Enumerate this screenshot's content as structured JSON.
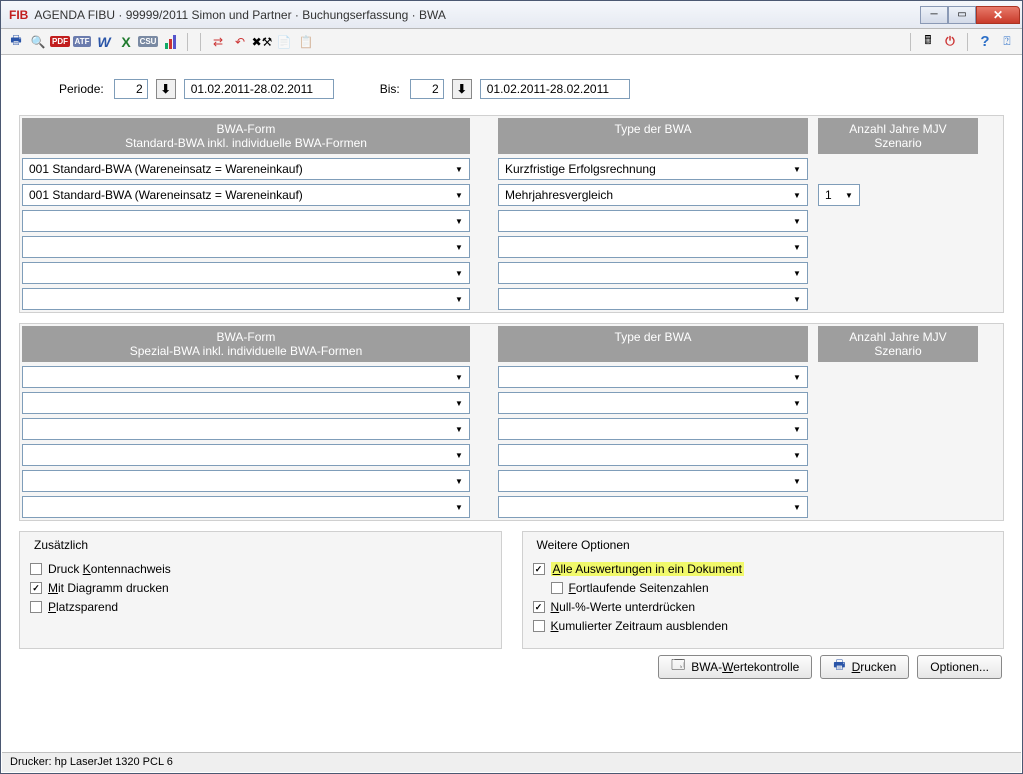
{
  "title": "AGENDA FIBU · 99999/2011 Simon und Partner · Buchungserfassung · BWA",
  "app_abbr": "FIB",
  "toolbar": {
    "print": "🖨",
    "preview": "🔍",
    "pdf": "PDF",
    "atf": "ATF",
    "w": "W",
    "x": "X",
    "csv": "CSU",
    "calc": "🖩",
    "help": "?",
    "whats": "?"
  },
  "period": {
    "label": "Periode:",
    "from_num": "2",
    "from_date": "01.02.2011-28.02.2011",
    "to_label": "Bis:",
    "to_num": "2",
    "to_date": "01.02.2011-28.02.2011"
  },
  "headers": {
    "bwa_form": "BWA-Form",
    "std_sub": "Standard-BWA inkl. individuelle BWA-Formen",
    "spezial_sub": "Spezial-BWA inkl. individuelle BWA-Formen",
    "type": "Type der BWA",
    "mjv": "Anzahl Jahre MJV",
    "szenario": "Szenario"
  },
  "std_rows": [
    {
      "form": "001 Standard-BWA (Wareneinsatz = Wareneinkauf)",
      "type": "Kurzfristige Erfolgsrechnung",
      "mjv": ""
    },
    {
      "form": "001 Standard-BWA (Wareneinsatz = Wareneinkauf)",
      "type": "Mehrjahresvergleich",
      "mjv": "1"
    },
    {
      "form": "",
      "type": "",
      "mjv": ""
    },
    {
      "form": "",
      "type": "",
      "mjv": ""
    },
    {
      "form": "",
      "type": "",
      "mjv": ""
    },
    {
      "form": "",
      "type": "",
      "mjv": ""
    }
  ],
  "spz_rows": [
    {
      "form": "",
      "type": "",
      "mjv": ""
    },
    {
      "form": "",
      "type": "",
      "mjv": ""
    },
    {
      "form": "",
      "type": "",
      "mjv": ""
    },
    {
      "form": "",
      "type": "",
      "mjv": ""
    },
    {
      "form": "",
      "type": "",
      "mjv": ""
    },
    {
      "form": "",
      "type": "",
      "mjv": ""
    }
  ],
  "zusatz": {
    "title": "Zusätzlich",
    "kontennachweis_pre": "Druck ",
    "kontennachweis_u": "K",
    "kontennachweis_post": "ontennachweis",
    "diagramm_u": "M",
    "diagramm_post": "it Diagramm drucken",
    "platz_u": "P",
    "platz_post": "latzsparend"
  },
  "weitere": {
    "title": "Weitere Optionen",
    "alle_u": "A",
    "alle_post": "lle Auswertungen in ein Dokument",
    "fort_u": "F",
    "fort_post": "ortlaufende Seitenzahlen",
    "null_u": "N",
    "null_post": "ull-%-Werte unterdrücken",
    "kum_u": "K",
    "kum_post": "umulierter Zeitraum ausblenden"
  },
  "buttons": {
    "werte_u": "W",
    "werte_pre": "BWA-",
    "werte_post": "ertekontrolle",
    "drucken_u": "D",
    "drucken_post": "rucken",
    "optionen": "Optionen..."
  },
  "status": "Drucker: hp LaserJet 1320 PCL 6"
}
